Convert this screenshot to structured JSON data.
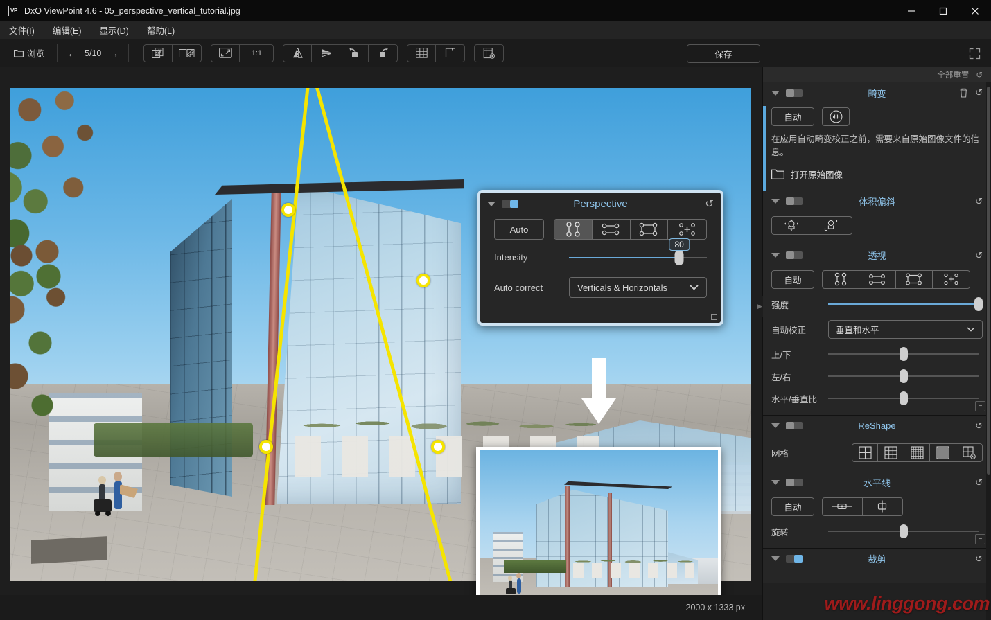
{
  "window": {
    "app_badge": "VP",
    "title": "DxO ViewPoint 4.6 - 05_perspective_vertical_tutorial.jpg",
    "minimize": "—",
    "maximize": "☐",
    "close": "✕"
  },
  "menu": [
    {
      "label": "文件(I)",
      "name": "menu-file"
    },
    {
      "label": "编辑(E)",
      "name": "menu-edit"
    },
    {
      "label": "显示(D)",
      "name": "menu-view"
    },
    {
      "label": "帮助(L)",
      "name": "menu-help"
    }
  ],
  "toolbar": {
    "browse_label": "浏览",
    "prev_arrow": "←",
    "next_arrow": "→",
    "counter": "5/10",
    "zoom_ratio": "1:1",
    "save_label": "保存",
    "icons": [
      "compare-overlay-icon",
      "compare-split-icon",
      "fit-to-screen-icon",
      "zoom-100-icon",
      "flip-horizontal-icon",
      "flip-vertical-icon",
      "rotate-left-icon",
      "rotate-right-icon",
      "grid-icon",
      "ruler-icon",
      "export-preset-icon"
    ]
  },
  "callout": {
    "title": "Perspective",
    "auto_label": "Auto",
    "intensity_label": "Intensity",
    "intensity_value": "80",
    "intensity_percent": 80,
    "auto_correct_label": "Auto correct",
    "auto_correct_value": "Verticals & Horizontals",
    "modes": [
      "parallel-vertical-icon",
      "parallel-horizontal-icon",
      "rectangle-icon",
      "eight-point-icon"
    ],
    "active_mode_index": 0,
    "reset_icon": "↺",
    "toggle_state": "on"
  },
  "canvas": {
    "image_size": "2000 x 1333 px",
    "guide_color": "#f5e400",
    "handle_count": 4,
    "arrow_name": "before-after-arrow"
  },
  "sidebar": {
    "reset_all_label": "全部重置",
    "reset_all_icon": "↺",
    "panels": [
      {
        "name": "distortion",
        "title": "畸变",
        "toggle": "off",
        "auto_label": "自动",
        "icon_button": "lens-distortion-icon",
        "hint": "在应用自动畸变校正之前，需要来自原始图像文件的信息。",
        "open_link": "打开原始图像",
        "trash_icon": "🗑",
        "reset_icon": "↺"
      },
      {
        "name": "volume-deformation",
        "title": "体积偏斜",
        "toggle": "off",
        "reset_icon": "↺",
        "buttons": [
          "volume-radial-icon",
          "volume-corner-icon"
        ]
      },
      {
        "name": "perspective",
        "title": "透视",
        "toggle": "off",
        "reset_icon": "↺",
        "auto_label": "自动",
        "modes": [
          "parallel-vertical-icon",
          "parallel-horizontal-icon",
          "rectangle-icon",
          "eight-point-icon"
        ],
        "intensity_label": "强度",
        "intensity_percent": 100,
        "auto_correct_label": "自动校正",
        "auto_correct_value": "垂直和水平",
        "sliders": [
          {
            "label": "上/下",
            "percent": 50
          },
          {
            "label": "左/右",
            "percent": 50
          },
          {
            "label": "水平/垂直比",
            "percent": 50
          }
        ]
      },
      {
        "name": "reshape",
        "title": "ReShape",
        "toggle": "off",
        "reset_icon": "↺",
        "grid_label": "网格",
        "grid_options": [
          "grid-2x2-icon",
          "grid-3x3-icon",
          "grid-5x5-icon",
          "grid-dense-icon",
          "grid-off-icon"
        ]
      },
      {
        "name": "horizon",
        "title": "水平线",
        "toggle": "off",
        "reset_icon": "↺",
        "auto_label": "自动",
        "buttons": [
          "horizon-line-icon",
          "horizon-vertical-icon"
        ],
        "rotate_label": "旋转",
        "rotate_percent": 50
      },
      {
        "name": "crop",
        "title": "裁剪",
        "toggle": "on",
        "reset_icon": "↺"
      }
    ]
  },
  "watermark": {
    "text": "www.linggong.com",
    "color": "#9e1b1b"
  }
}
